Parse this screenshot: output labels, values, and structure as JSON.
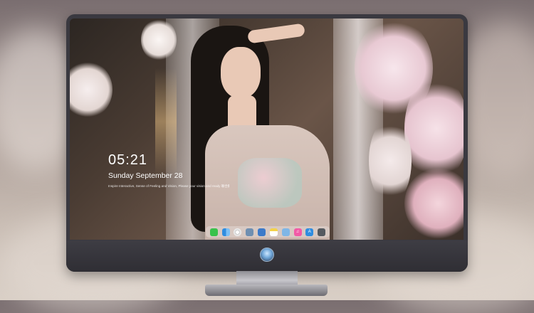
{
  "lock_screen": {
    "time": "05:21",
    "date": "Sunday September  28",
    "ticker": "Inspire Interactive, Sense of Feeling and Vision, Please your vision and ready 聯合動畫 有效地方 未來感受"
  },
  "dock": {
    "apps": [
      {
        "name": "messages-icon",
        "color": "#39c24b",
        "glyph": ""
      },
      {
        "name": "finder-icon",
        "color": "#2f8de0",
        "glyph": ""
      },
      {
        "name": "safari-icon",
        "color": "#ececec",
        "glyph": ""
      },
      {
        "name": "preview-icon",
        "color": "#6f8fb1",
        "glyph": ""
      },
      {
        "name": "clapper-icon",
        "color": "#3c7ac9",
        "glyph": ""
      },
      {
        "name": "notes-icon",
        "color": "#f4d24a",
        "glyph": ""
      },
      {
        "name": "photos-icon",
        "color": "#7fb6e6",
        "glyph": ""
      },
      {
        "name": "music-icon",
        "color": "#f25aa6",
        "glyph": "♫"
      },
      {
        "name": "app-store-icon",
        "color": "#2f8de0",
        "glyph": "A"
      },
      {
        "name": "camera-icon",
        "color": "#555a60",
        "glyph": ""
      }
    ]
  }
}
